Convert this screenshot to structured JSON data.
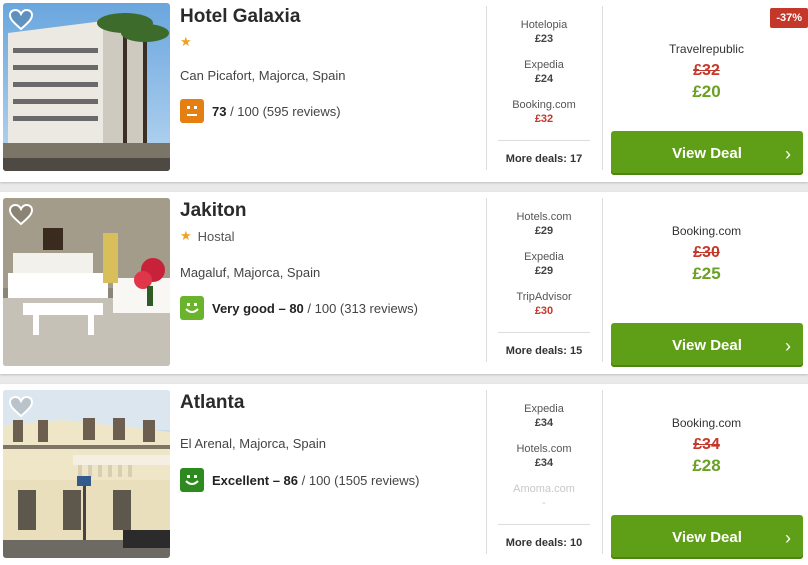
{
  "hotels": [
    {
      "name": "Hotel Galaxia",
      "stars": 1,
      "type": "",
      "location": "Can Picafort, Majorca, Spain",
      "rating_score": "73",
      "rating_label": "",
      "rating_rest": " / 100 (595 reviews)",
      "rating_color": "#e57f12",
      "deals": [
        {
          "site": "Hotelopia",
          "price": "£23"
        },
        {
          "site": "Expedia",
          "price": "£24"
        },
        {
          "site": "Booking.com",
          "price": "£32"
        }
      ],
      "more_deals": "More deals: 17",
      "best": {
        "provider": "Travelrepublic",
        "old_price": "£32",
        "new_price": "£20"
      },
      "badge": "-37%",
      "view_deal": "View Deal"
    },
    {
      "name": "Jakiton",
      "stars": 1,
      "type": "Hostal",
      "location": "Magaluf, Majorca, Spain",
      "rating_score": "80",
      "rating_label": "Very good – ",
      "rating_rest": " / 100 (313 reviews)",
      "rating_color": "#6ab32c",
      "deals": [
        {
          "site": "Hotels.com",
          "price": "£29"
        },
        {
          "site": "Expedia",
          "price": "£29"
        },
        {
          "site": "TripAdvisor",
          "price": "£30"
        }
      ],
      "more_deals": "More deals: 15",
      "best": {
        "provider": "Booking.com",
        "old_price": "£30",
        "new_price": "£25"
      },
      "view_deal": "View Deal"
    },
    {
      "name": "Atlanta",
      "stars": 0,
      "type": "",
      "location": "El Arenal, Majorca, Spain",
      "rating_score": "86",
      "rating_label": "Excellent – ",
      "rating_rest": " / 100 (1505 reviews)",
      "rating_color": "#2d8a1f",
      "deals": [
        {
          "site": "Expedia",
          "price": "£34"
        },
        {
          "site": "Hotels.com",
          "price": "£34"
        },
        {
          "site": "Amoma.com",
          "price": "-"
        }
      ],
      "more_deals": "More deals: 10",
      "best": {
        "provider": "Booking.com",
        "old_price": "£34",
        "new_price": "£28"
      },
      "view_deal": "View Deal"
    }
  ]
}
